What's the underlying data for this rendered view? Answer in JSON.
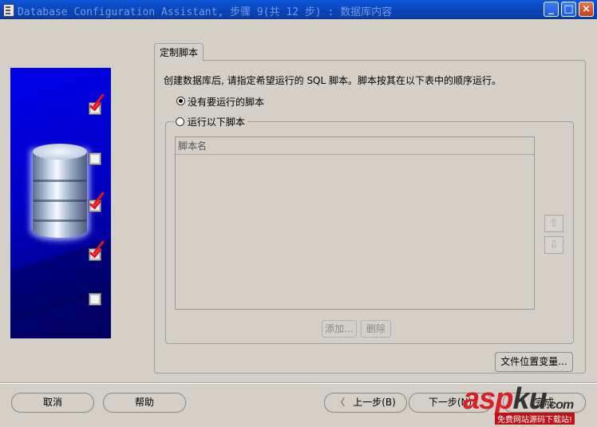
{
  "window": {
    "title": "Database Configuration Assistant, 步骤 9(共 12 步) : 数据库内容",
    "minimize_label": "_",
    "maximize_label": "□",
    "close_label": "×"
  },
  "tab": {
    "label": "定制脚本"
  },
  "description": "创建数据库后, 请指定希望运行的 SQL 脚本。脚本按其在以下表中的顺序运行。",
  "options": {
    "no_scripts": {
      "label": "没有要运行的脚本",
      "selected": true
    },
    "run_scripts": {
      "label": "运行以下脚本",
      "selected": false
    }
  },
  "table": {
    "column_header": "脚本名"
  },
  "reorder": {
    "up_icon": "arrow-up-icon",
    "down_icon": "arrow-down-icon",
    "up_glyph": "⇧",
    "down_glyph": "⇩"
  },
  "buttons": {
    "add": "添加...",
    "delete": "删除",
    "file_location_vars": "文件位置变量...",
    "cancel": "取消",
    "help": "帮助",
    "back": "上一步(B)",
    "back_glyph": "〈",
    "next": "下一步(N)",
    "finish": "完成"
  },
  "watermark": {
    "brand_a": "asp",
    "brand_b": "ku",
    "domain": ".com",
    "tagline": "免费网站源码下载站!"
  },
  "colors": {
    "titlebar": "#0a44b8",
    "check": "#e8121b",
    "side_panel": "#0000c8"
  }
}
